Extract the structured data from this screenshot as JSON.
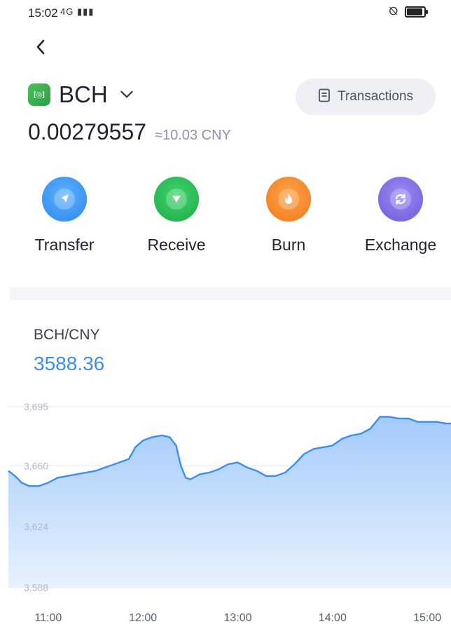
{
  "status_bar": {
    "time": "15:02",
    "signal": "4G ▮▮▮",
    "wifi": "wifi-icon",
    "battery_level": 0.9
  },
  "header": {
    "back_icon": "chevron-left-icon"
  },
  "coin": {
    "logo_icon": "bch-coin-icon",
    "logo_color": "#3fb256",
    "name": "BCH",
    "dropdown_icon": "chevron-down-icon"
  },
  "transactions_button": {
    "icon": "document-icon",
    "label": "Transactions"
  },
  "balance": {
    "amount": "0.00279557",
    "fiat": "≈10.03 CNY"
  },
  "actions": [
    {
      "label": "Transfer",
      "icon": "send-icon",
      "color": "#3d96f5"
    },
    {
      "label": "Receive",
      "icon": "receive-icon",
      "color": "#27bd56"
    },
    {
      "label": "Burn",
      "icon": "fire-icon",
      "color": "#f5892c"
    },
    {
      "label": "Exchange",
      "icon": "swap-icon",
      "color": "#8471e6"
    }
  ],
  "market": {
    "pair": "BCH/CNY",
    "price": "3588.36"
  },
  "chart_data": {
    "type": "area",
    "x_ticks": [
      "11:00",
      "12:00",
      "13:00",
      "14:00",
      "15:00"
    ],
    "y_ticks": [
      "3,695",
      "3,660",
      "3,624",
      "3,588"
    ],
    "ylim": [
      3588,
      3695
    ],
    "xlim": [
      10.58,
      15.25
    ],
    "line_color": "#3b8df0",
    "grid": true,
    "x": [
      10.58,
      10.65,
      10.72,
      10.8,
      10.9,
      11.0,
      11.1,
      11.2,
      11.3,
      11.4,
      11.5,
      11.6,
      11.7,
      11.85,
      11.92,
      12.0,
      12.1,
      12.2,
      12.28,
      12.35,
      12.4,
      12.45,
      12.5,
      12.6,
      12.7,
      12.8,
      12.9,
      13.0,
      13.1,
      13.2,
      13.3,
      13.4,
      13.5,
      13.6,
      13.7,
      13.8,
      13.9,
      14.0,
      14.1,
      14.2,
      14.3,
      14.4,
      14.5,
      14.6,
      14.7,
      14.8,
      14.9,
      15.0,
      15.1,
      15.2,
      15.25
    ],
    "y": [
      3657,
      3654,
      3650,
      3648,
      3648,
      3650,
      3653,
      3654,
      3655,
      3656,
      3657,
      3659,
      3661,
      3664,
      3671,
      3675,
      3677,
      3678,
      3677,
      3672,
      3660,
      3653,
      3652,
      3655,
      3656,
      3658,
      3661,
      3662,
      3659,
      3657,
      3654,
      3654,
      3656,
      3661,
      3667,
      3670,
      3671,
      3672,
      3676,
      3678,
      3679,
      3682,
      3689,
      3689,
      3688,
      3688,
      3686,
      3686,
      3686,
      3685,
      3685
    ]
  }
}
